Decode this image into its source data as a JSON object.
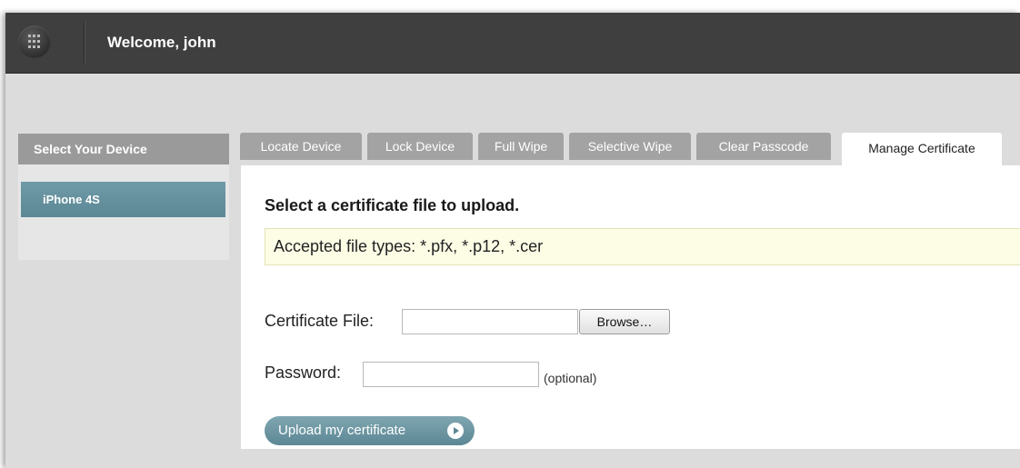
{
  "header": {
    "welcome_text": "Welcome, john",
    "logo_icon": "grid-logo-icon"
  },
  "sidebar": {
    "title": "Select Your Device",
    "devices": [
      {
        "label": "iPhone 4S",
        "selected": true
      }
    ]
  },
  "tabs": [
    {
      "label": "Locate Device",
      "active": false
    },
    {
      "label": "Lock Device",
      "active": false
    },
    {
      "label": "Full Wipe",
      "active": false
    },
    {
      "label": "Selective Wipe",
      "active": false
    },
    {
      "label": "Clear Passcode",
      "active": false
    },
    {
      "label": "Manage Certificate",
      "active": true
    }
  ],
  "content": {
    "title": "Select a certificate file to upload.",
    "notice": "Accepted file types: *.pfx, *.p12, *.cer",
    "certificate_label": "Certificate File:",
    "certificate_value": "",
    "browse_label": "Browse…",
    "password_label": "Password:",
    "password_value": "",
    "optional_note": "(optional)",
    "upload_label": "Upload my certificate"
  },
  "colors": {
    "topbar": "#3f3f3f",
    "accent": "#5c8896",
    "tab_inactive": "#a3a3a3",
    "notice_bg": "#fdfde6"
  }
}
